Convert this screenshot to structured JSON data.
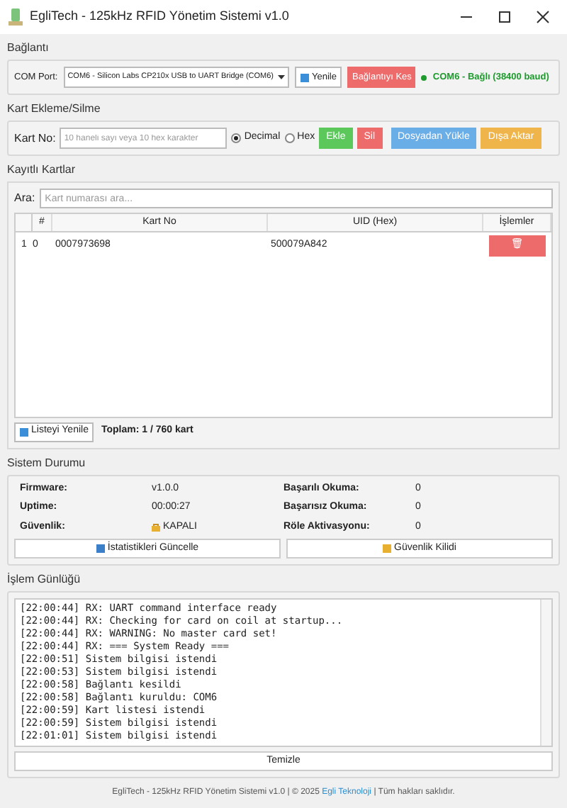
{
  "window": {
    "title": "EgliTech - 125kHz RFID Yönetim Sistemi v1.0"
  },
  "connection": {
    "title": "Bağlantı",
    "port_label": "COM Port:",
    "port_value": "COM6 - Silicon Labs CP210x USB to UART Bridge (COM6)",
    "refresh_button": "Yenile",
    "disconnect_button": "Bağlantıyı Kes",
    "status": "COM6 - Bağlı (38400 baud)",
    "connected": true
  },
  "add_card": {
    "title": "Kart Ekleme/Silme",
    "card_label": "Kart No:",
    "placeholder": "10 haneli sayı veya 10 hex karakter",
    "formats": [
      {
        "label": "Decimal",
        "selected": true
      },
      {
        "label": "Hex",
        "selected": false
      }
    ],
    "buttons": [
      {
        "label": "Ekle",
        "color": "#5cc85c"
      },
      {
        "label": "Sil",
        "color": "#ee6b6b"
      },
      {
        "label": "Dosyadan Yükle",
        "color": "#6aaee8"
      },
      {
        "label": "Dışa Aktar",
        "color": "#f0b54a"
      }
    ]
  },
  "cards": {
    "title": "Kayıtlı Kartlar",
    "search_label": "Ara:",
    "search_placeholder": "Kart numarası ara...",
    "columns": [
      "#",
      "Kart No",
      "UID (Hex)",
      "İşlemler"
    ],
    "rows": [
      {
        "row_header": "1",
        "index": "0",
        "card_no": "0007973698",
        "uid": "500079A842",
        "delete": "🗑"
      }
    ],
    "refresh_button": "Listeyi Yenile",
    "total": "Toplam: 1 / 760 kart"
  },
  "system": {
    "title": "Sistem Durumu",
    "stats": [
      {
        "label": "Firmware:",
        "value": "v1.0.0"
      },
      {
        "label": "Başarılı Okuma:",
        "value": "0"
      },
      {
        "label": "Uptime:",
        "value": "00:00:27"
      },
      {
        "label": "Başarısız Okuma:",
        "value": "0"
      },
      {
        "label": "Güvenlik:",
        "value": "KAPALI",
        "icon": true
      },
      {
        "label": "Röle Aktivasyonu:",
        "value": "0"
      }
    ],
    "buttons": [
      "İstatistikleri Güncelle",
      "Güvenlik Kilidi"
    ]
  },
  "log": {
    "title": "İşlem Günlüğü",
    "lines": [
      "[22:00:44] RX: UART command interface ready",
      "[22:00:44] RX: Checking for card on coil at startup...",
      "[22:00:44] RX: WARNING: No master card set!",
      "[22:00:44] RX: === System Ready ===",
      "[22:00:51] Sistem bilgisi istendi",
      "[22:00:53] Sistem bilgisi istendi",
      "[22:00:58] Bağlantı kesildi",
      "[22:00:58] Bağlantı kuruldu: COM6",
      "[22:00:59] Kart listesi istendi",
      "[22:00:59] Sistem bilgisi istendi",
      "[22:01:01] Sistem bilgisi istendi"
    ],
    "clear_button": "Temizle"
  },
  "footer": {
    "text": "EgliTech - 125kHz RFID Yönetim Sistemi v1.0 | © 2025",
    "link": "Egli Teknoloji",
    "rest": "| Tüm hakları saklıdır."
  }
}
